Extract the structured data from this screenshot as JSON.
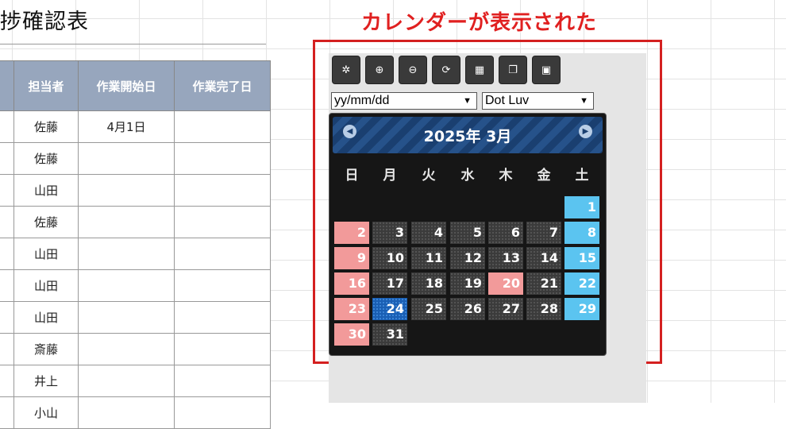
{
  "sheet": {
    "title": "捗確認表",
    "headers": [
      "",
      "担当者",
      "作業開始日",
      "作業完了日"
    ],
    "rows": [
      [
        "",
        "佐藤",
        "4月1日",
        ""
      ],
      [
        "",
        "佐藤",
        "",
        ""
      ],
      [
        "",
        "山田",
        "",
        ""
      ],
      [
        "",
        "佐藤",
        "",
        ""
      ],
      [
        "",
        "山田",
        "",
        ""
      ],
      [
        "",
        "山田",
        "",
        ""
      ],
      [
        "",
        "山田",
        "",
        ""
      ],
      [
        "",
        "斎藤",
        "",
        ""
      ],
      [
        "",
        "井上",
        "",
        ""
      ],
      [
        "",
        "小山",
        "",
        ""
      ]
    ]
  },
  "annotation": {
    "text": "カレンダーが表示された",
    "color": "#e02020"
  },
  "toolbar": {
    "buttons": [
      {
        "name": "settings-gear-button",
        "glyph": "✲"
      },
      {
        "name": "zoom-in-button",
        "glyph": "⊕"
      },
      {
        "name": "zoom-out-button",
        "glyph": "⊖"
      },
      {
        "name": "refresh-button",
        "glyph": "⟳"
      },
      {
        "name": "grid-button",
        "glyph": "▦"
      },
      {
        "name": "window-button",
        "glyph": "❐"
      },
      {
        "name": "card-button",
        "glyph": "▣"
      }
    ]
  },
  "date_format_select": {
    "value": "yy/mm/dd"
  },
  "theme_select": {
    "value": "Dot Luv"
  },
  "calendar": {
    "header": "2025年 3月",
    "weekdays": [
      "日",
      "月",
      "火",
      "水",
      "木",
      "金",
      "土"
    ],
    "first_weekday_index": 6,
    "days_in_month": 31,
    "today": 24,
    "highlighted": [
      20
    ],
    "colors": {
      "sunday": "#f29a9a",
      "saturday": "#5bc4f0",
      "today": "#1a5fb4",
      "accent": "#1a3f70"
    }
  }
}
